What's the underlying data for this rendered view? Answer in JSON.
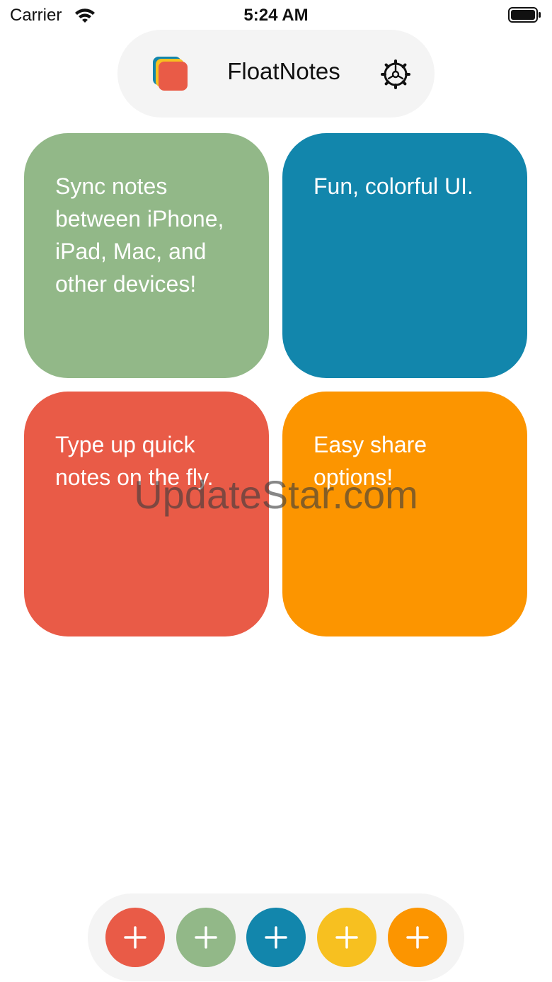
{
  "status_bar": {
    "carrier": "Carrier",
    "time": "5:24 AM",
    "icons": [
      "wifi-icon",
      "battery-icon"
    ]
  },
  "header": {
    "title": "FloatNotes",
    "logo_icon": "stacked-notes-logo-icon",
    "settings_icon": "gear-icon"
  },
  "notes": [
    {
      "text": "Sync notes between iPhone, iPad, Mac, and other devices!",
      "color": "#92b888"
    },
    {
      "text": "Fun, colorful UI.",
      "color": "#1286ac"
    },
    {
      "text": "Type up quick notes on the fly.",
      "color": "#e95b47"
    },
    {
      "text": "Easy share options!",
      "color": "#fc9500"
    }
  ],
  "watermark": "UpdateStar.com",
  "add_buttons": [
    {
      "color": "#e95b47",
      "icon": "plus-icon"
    },
    {
      "color": "#92b888",
      "icon": "plus-icon"
    },
    {
      "color": "#1286ac",
      "icon": "plus-icon"
    },
    {
      "color": "#f7c020",
      "icon": "plus-icon"
    },
    {
      "color": "#fc9500",
      "icon": "plus-icon"
    }
  ]
}
